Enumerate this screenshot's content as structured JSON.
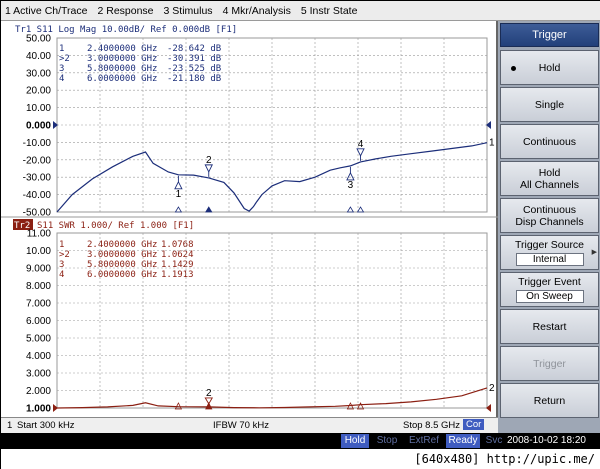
{
  "menu": [
    "1 Active Ch/Trace",
    "2 Response",
    "3 Stimulus",
    "4 Mkr/Analysis",
    "5 Instr State"
  ],
  "colors": {
    "trace1": "#1c2e7a",
    "trace2": "#8b1f12",
    "grid": "#9a9a9a",
    "softkey_title": "#2a4888",
    "accent_yellow": "#f0d000",
    "cor_blue": "#3f5cc0"
  },
  "trace1": {
    "header": "Tr1  S11  Log Mag  10.00dB/  Ref 0.000dB  [F1]",
    "y_ticks": [
      "50.00",
      "40.00",
      "30.00",
      "20.00",
      "10.00",
      "0.000",
      "-10.00",
      "-20.00",
      "-30.00",
      "-40.00",
      "-50.00"
    ],
    "markers": [
      {
        "id": "1",
        "freq": "2.4000000 GHz",
        "value": "-28.642 dB"
      },
      {
        "id": ">2",
        "freq": "3.0000000 GHz",
        "value": "-30.391 dB"
      },
      {
        "id": "3",
        "freq": "5.8000000 GHz",
        "value": "-23.525 dB"
      },
      {
        "id": "4",
        "freq": "6.0000000 GHz",
        "value": "-21.180 dB"
      }
    ],
    "marker_labels": [
      "1",
      "2",
      "3",
      "4"
    ],
    "end_label": "1"
  },
  "trace2": {
    "header_num": "Tr2",
    "header": "S11  SWR 1.000/  Ref 1.000  [F1]",
    "y_ticks": [
      "11.00",
      "10.00",
      "9.000",
      "8.000",
      "7.000",
      "6.000",
      "5.000",
      "4.000",
      "3.000",
      "2.000",
      "1.000"
    ],
    "markers": [
      {
        "id": "1",
        "freq": "2.4000000 GHz",
        "value": "1.0768"
      },
      {
        "id": ">2",
        "freq": "3.0000000 GHz",
        "value": "1.0624"
      },
      {
        "id": "3",
        "freq": "5.8000000 GHz",
        "value": "1.1429"
      },
      {
        "id": "4",
        "freq": "6.0000000 GHz",
        "value": "1.1913"
      }
    ],
    "marker_label_active": "2",
    "end_label": "2"
  },
  "footer": {
    "channel": "1",
    "start": "Start 300 kHz",
    "ifbw": "IFBW 70 kHz",
    "stop": "Stop 8.5 GHz",
    "cor": "Cor"
  },
  "softkeys": {
    "title": "Trigger",
    "hold": "Hold",
    "single": "Single",
    "continuous": "Continuous",
    "hold_all_1": "Hold",
    "hold_all_2": "All Channels",
    "cont_disp_1": "Continuous",
    "cont_disp_2": "Disp Channels",
    "trig_source": "Trigger Source",
    "trig_source_val": "Internal",
    "trig_event": "Trigger Event",
    "trig_event_val": "On Sweep",
    "restart": "Restart",
    "trigger": "Trigger",
    "return": "Return"
  },
  "status": {
    "hold": "Hold",
    "stop": "Stop",
    "extref": "ExtRef",
    "ready": "Ready",
    "svc": "Svc",
    "datetime": "2008-10-02 18:20"
  },
  "caption": "[640x480] http://upic.me/",
  "chart_data": [
    {
      "type": "line",
      "title": "Tr1 S11 Log Mag 10.00dB/ Ref 0.000dB [F1]",
      "ylim": [
        -50,
        50
      ],
      "xlim_ghz": [
        0.0003,
        8.5
      ],
      "units": "dB",
      "series": [
        {
          "x": [
            0.0003,
            0.3,
            0.7,
            1.1,
            1.5,
            1.75,
            1.9,
            2.2,
            2.4,
            2.7,
            3.0,
            3.3,
            3.5,
            3.7,
            3.8,
            3.88,
            3.95,
            4.05,
            4.25,
            4.5,
            4.8,
            5.1,
            5.4,
            5.6,
            5.8,
            6.0,
            6.3,
            6.6,
            7.0,
            7.4,
            7.8,
            8.2,
            8.5
          ],
          "y": [
            -50,
            -40,
            -31,
            -24,
            -18,
            -15.5,
            -22,
            -27,
            -28.6,
            -28.8,
            -30.4,
            -33,
            -39,
            -48,
            -49.5,
            -47,
            -44,
            -40,
            -35,
            -32,
            -32.5,
            -30,
            -26,
            -24.6,
            -23.5,
            -21.2,
            -19.5,
            -18,
            -16.5,
            -15,
            -13.5,
            -12,
            -10.2
          ]
        }
      ],
      "markers": [
        {
          "x": 2.4,
          "y": -28.642
        },
        {
          "x": 3.0,
          "y": -30.391
        },
        {
          "x": 5.8,
          "y": -23.525
        },
        {
          "x": 6.0,
          "y": -21.18
        }
      ]
    },
    {
      "type": "line",
      "title": "S11 SWR 1.000/ Ref 1.000 [F1]",
      "ylim": [
        1,
        11
      ],
      "xlim_ghz": [
        0.0003,
        8.5
      ],
      "series": [
        {
          "x": [
            0.0003,
            0.5,
            1.0,
            1.5,
            1.75,
            2.0,
            2.4,
            3.0,
            3.5,
            4.0,
            4.5,
            5.0,
            5.5,
            5.8,
            6.0,
            6.5,
            7.0,
            7.5,
            8.0,
            8.5
          ],
          "y": [
            1.0,
            1.02,
            1.06,
            1.15,
            1.3,
            1.12,
            1.077,
            1.062,
            1.02,
            1.01,
            1.03,
            1.06,
            1.1,
            1.143,
            1.191,
            1.25,
            1.35,
            1.5,
            1.7,
            2.15
          ]
        }
      ],
      "markers": [
        {
          "x": 2.4,
          "y": 1.0768
        },
        {
          "x": 3.0,
          "y": 1.0624
        },
        {
          "x": 5.8,
          "y": 1.1429
        },
        {
          "x": 6.0,
          "y": 1.1913
        }
      ]
    }
  ]
}
